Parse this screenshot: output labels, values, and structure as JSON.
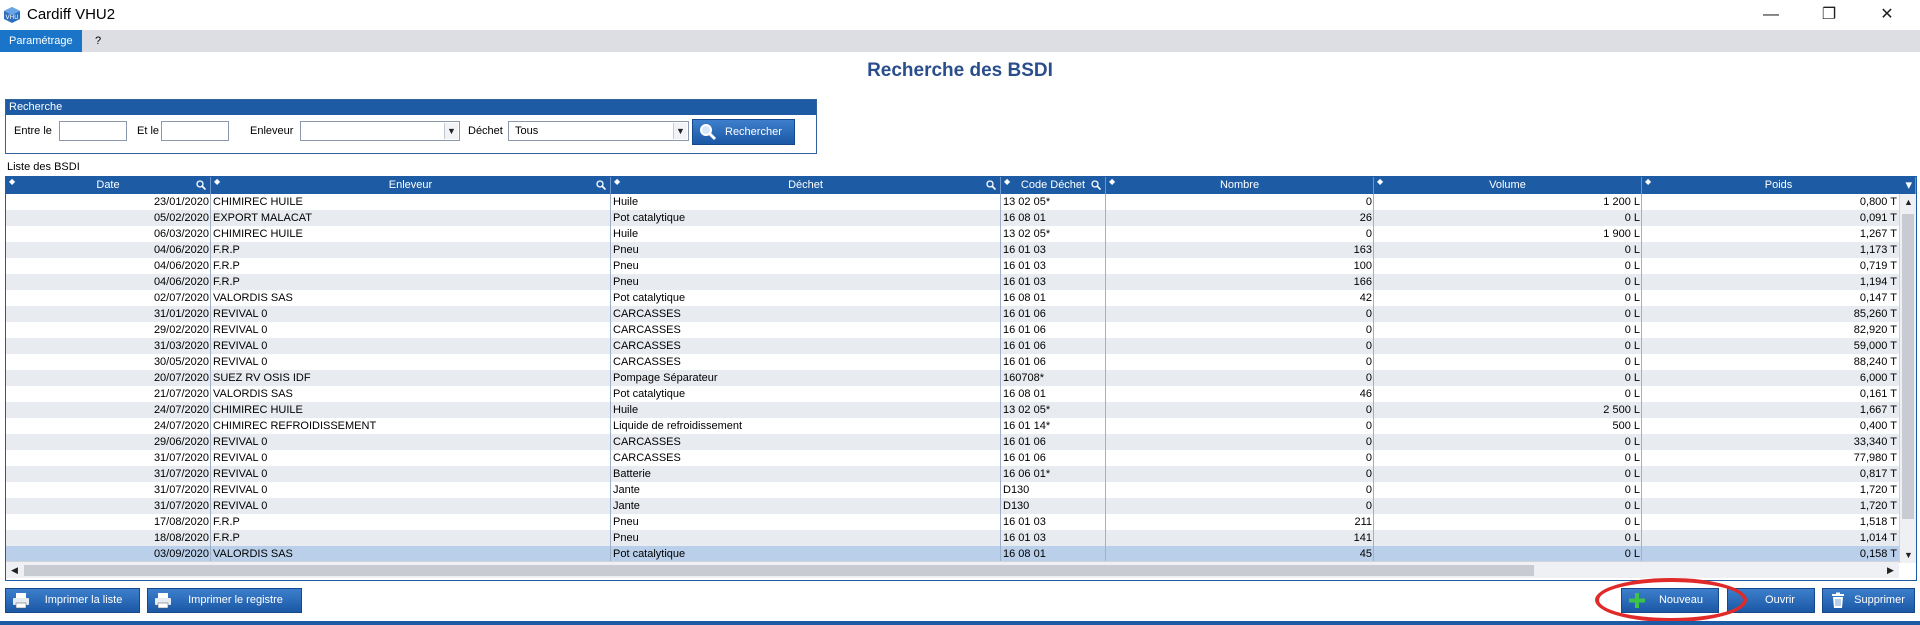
{
  "window": {
    "title": "Cardiff VHU2",
    "minimize": "—",
    "maximize": "❐",
    "close": "✕"
  },
  "menu": {
    "items": [
      "Paramétrage",
      "?"
    ]
  },
  "page_title": "Recherche des BSDI",
  "search": {
    "group_title": "Recherche",
    "from_label": "Entre le",
    "to_label": "Et le",
    "from_value": "",
    "to_value": "",
    "enleveur_label": "Enleveur",
    "enleveur_value": "",
    "dechet_label": "Déchet",
    "dechet_value": "Tous",
    "search_button": "Rechercher"
  },
  "list_label": "Liste des BSDI",
  "columns": [
    "Date",
    "Enleveur",
    "Déchet",
    "Code Déchet",
    "Nombre",
    "Volume",
    "Poids"
  ],
  "rows": [
    [
      "23/01/2020",
      "CHIMIREC HUILE",
      "Huile",
      "13 02 05*",
      "0",
      "1 200 L",
      "0,800 T"
    ],
    [
      "05/02/2020",
      "EXPORT MALACAT",
      "Pot catalytique",
      "16 08 01",
      "26",
      "0 L",
      "0,091 T"
    ],
    [
      "06/03/2020",
      "CHIMIREC HUILE",
      "Huile",
      "13 02 05*",
      "0",
      "1 900 L",
      "1,267 T"
    ],
    [
      "04/06/2020",
      "F.R.P",
      "Pneu",
      "16 01 03",
      "163",
      "0 L",
      "1,173 T"
    ],
    [
      "04/06/2020",
      "F.R.P",
      "Pneu",
      "16 01 03",
      "100",
      "0 L",
      "0,719 T"
    ],
    [
      "04/06/2020",
      "F.R.P",
      "Pneu",
      "16 01 03",
      "166",
      "0 L",
      "1,194 T"
    ],
    [
      "02/07/2020",
      "VALORDIS SAS",
      "Pot catalytique",
      "16 08 01",
      "42",
      "0 L",
      "0,147 T"
    ],
    [
      "31/01/2020",
      "REVIVAL 0",
      "CARCASSES",
      "16 01 06",
      "0",
      "0 L",
      "85,260 T"
    ],
    [
      "29/02/2020",
      "REVIVAL 0",
      "CARCASSES",
      "16 01 06",
      "0",
      "0 L",
      "82,920 T"
    ],
    [
      "31/03/2020",
      "REVIVAL 0",
      "CARCASSES",
      "16 01 06",
      "0",
      "0 L",
      "59,000 T"
    ],
    [
      "30/05/2020",
      "REVIVAL 0",
      "CARCASSES",
      "16 01 06",
      "0",
      "0 L",
      "88,240 T"
    ],
    [
      "20/07/2020",
      "SUEZ RV OSIS IDF",
      "Pompage Séparateur",
      "160708*",
      "0",
      "0 L",
      "6,000 T"
    ],
    [
      "21/07/2020",
      "VALORDIS SAS",
      "Pot catalytique",
      "16 08 01",
      "46",
      "0 L",
      "0,161 T"
    ],
    [
      "24/07/2020",
      "CHIMIREC HUILE",
      "Huile",
      "13 02 05*",
      "0",
      "2 500 L",
      "1,667 T"
    ],
    [
      "24/07/2020",
      "CHIMIREC REFROIDISSEMENT",
      "Liquide de refroidissement",
      "16 01 14*",
      "0",
      "500 L",
      "0,400 T"
    ],
    [
      "29/06/2020",
      "REVIVAL 0",
      "CARCASSES",
      "16 01 06",
      "0",
      "0 L",
      "33,340 T"
    ],
    [
      "31/07/2020",
      "REVIVAL 0",
      "CARCASSES",
      "16 01 06",
      "0",
      "0 L",
      "77,980 T"
    ],
    [
      "31/07/2020",
      "REVIVAL 0",
      "Batterie",
      "16 06 01*",
      "0",
      "0 L",
      "0,817 T"
    ],
    [
      "31/07/2020",
      "REVIVAL 0",
      "Jante",
      "D130",
      "0",
      "0 L",
      "1,720 T"
    ],
    [
      "31/07/2020",
      "REVIVAL 0",
      "Jante",
      "D130",
      "0",
      "0 L",
      "1,720 T"
    ],
    [
      "17/08/2020",
      "F.R.P",
      "Pneu",
      "16 01 03",
      "211",
      "0 L",
      "1,518 T"
    ],
    [
      "18/08/2020",
      "F.R.P",
      "Pneu",
      "16 01 03",
      "141",
      "0 L",
      "1,014 T"
    ],
    [
      "03/09/2020",
      "VALORDIS SAS",
      "Pot catalytique",
      "16 08 01",
      "45",
      "0 L",
      "0,158 T"
    ]
  ],
  "selected_row": 22,
  "buttons": {
    "print_list": "Imprimer la liste",
    "print_register": "Imprimer le registre",
    "new": "Nouveau",
    "open": "Ouvrir",
    "delete": "Supprimer"
  },
  "colors": {
    "accent": "#1d5ca5",
    "title": "#2a4e8c",
    "highlight": "#e02a2a"
  }
}
